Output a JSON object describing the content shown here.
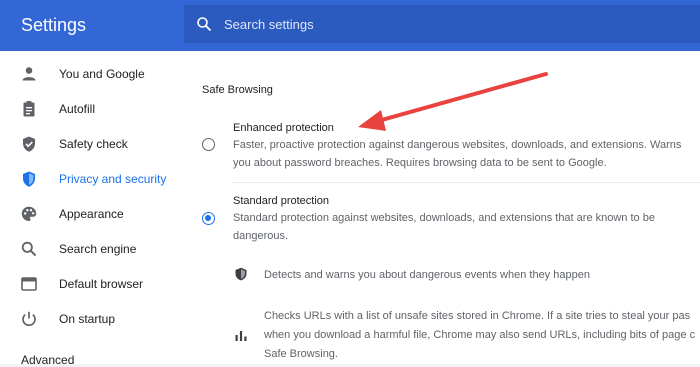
{
  "header": {
    "title": "Settings",
    "search_placeholder": "Search settings"
  },
  "sidebar": {
    "items": [
      {
        "label": "You and Google",
        "icon": "person-icon",
        "active": false
      },
      {
        "label": "Autofill",
        "icon": "clipboard-icon",
        "active": false
      },
      {
        "label": "Safety check",
        "icon": "shield-check-icon",
        "active": false
      },
      {
        "label": "Privacy and security",
        "icon": "shield-icon",
        "active": true
      },
      {
        "label": "Appearance",
        "icon": "palette-icon",
        "active": false
      },
      {
        "label": "Search engine",
        "icon": "search-icon",
        "active": false
      },
      {
        "label": "Default browser",
        "icon": "browser-icon",
        "active": false
      },
      {
        "label": "On startup",
        "icon": "power-icon",
        "active": false
      }
    ],
    "advanced_label": "Advanced"
  },
  "main": {
    "section_title": "Safe Browsing",
    "options": [
      {
        "title": "Enhanced protection",
        "desc_line1": "Faster, proactive protection against dangerous websites, downloads, and extensions. Warns",
        "desc_line2": "you about password breaches. Requires browsing data to be sent to Google.",
        "selected": false
      },
      {
        "title": "Standard protection",
        "desc_line1": "Standard protection against websites, downloads, and extensions that are known to be",
        "desc_line2": "dangerous.",
        "selected": true
      }
    ],
    "features": [
      {
        "icon": "shield-icon",
        "line1": "Detects and warns you about dangerous events when they happen"
      },
      {
        "icon": "bar-chart-icon",
        "line1": "Checks URLs with a list of unsafe sites stored in Chrome. If a site tries to steal your pas",
        "line2": "when you download a harmful file, Chrome may also send URLs, including bits of page c",
        "line3": "Safe Browsing."
      }
    ]
  },
  "colors": {
    "header_bg": "#3367d6",
    "accent": "#1a73e8",
    "annotation_arrow": "#e8433f"
  }
}
